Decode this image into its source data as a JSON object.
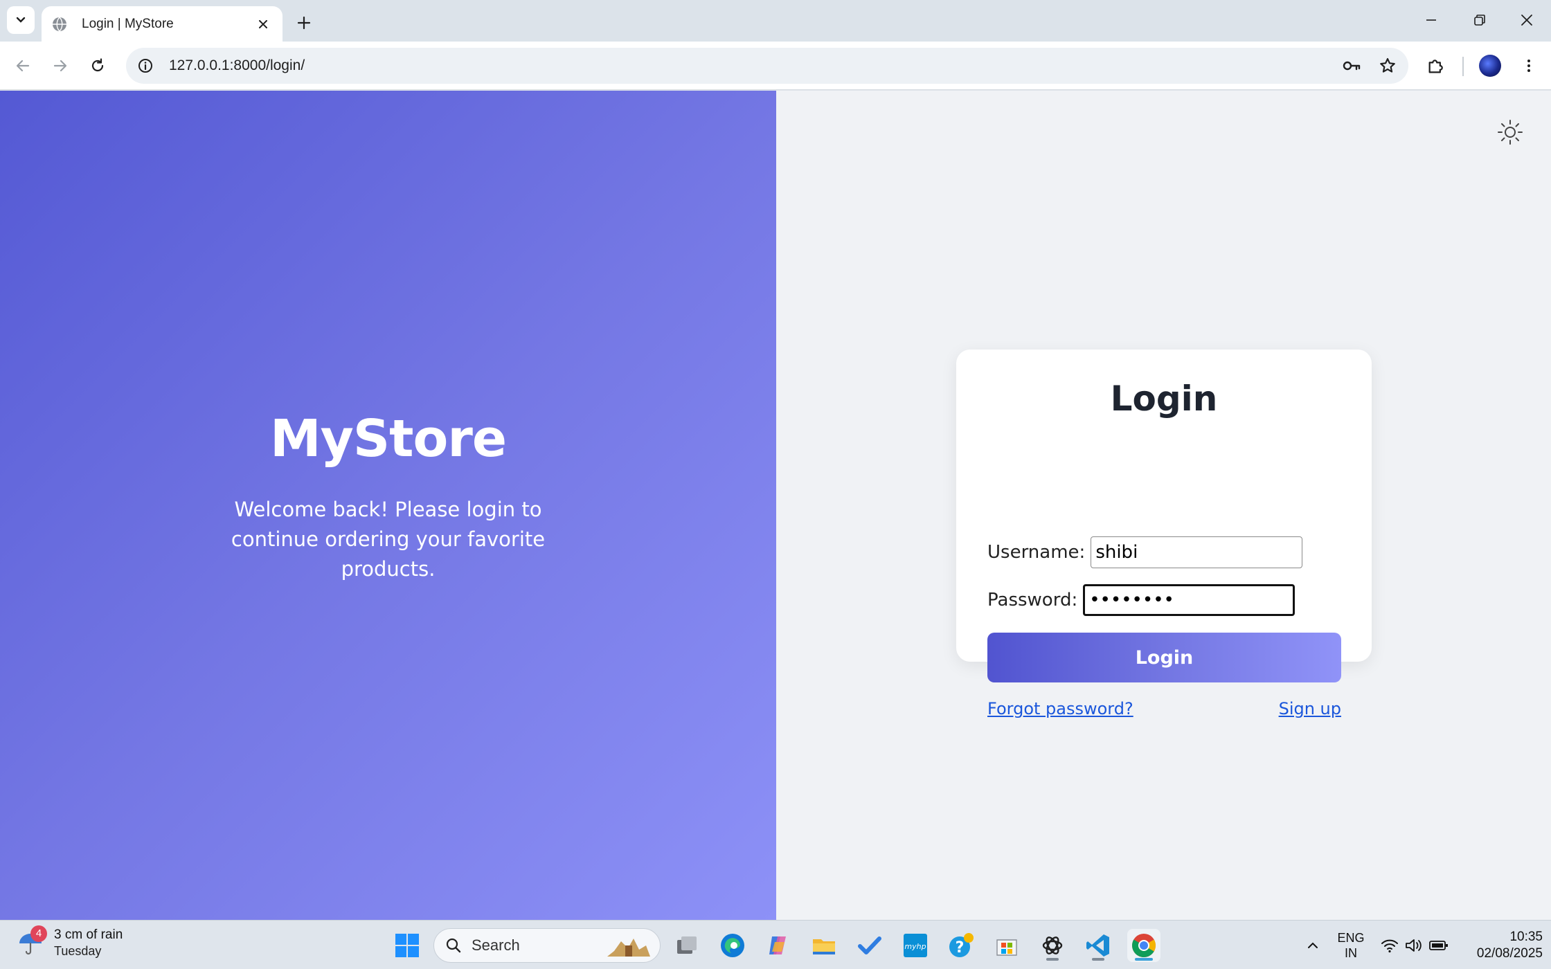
{
  "browser": {
    "tab_title": "Login | MyStore",
    "url": "127.0.0.1:8000/login/"
  },
  "brand": {
    "name": "MyStore",
    "tagline": "Welcome back! Please login to continue ordering your favorite products."
  },
  "login_form": {
    "title": "Login",
    "username_label": "Username:",
    "username_value": "shibi",
    "password_label": "Password:",
    "password_value": "••••••••",
    "submit_label": "Login",
    "forgot_link": "Forgot password?",
    "signup_link": "Sign up"
  },
  "colors": {
    "hero_gradient_start": "#5459d4",
    "hero_gradient_end": "#8d91f7",
    "page_background": "#f0f2f5",
    "button_gradient_start": "#5154d0",
    "button_gradient_end": "#9093f8",
    "link": "#1a56db"
  },
  "taskbar": {
    "weather": {
      "badge": "4",
      "line1": "3 cm of rain",
      "line2": "Tuesday"
    },
    "search_label": "Search",
    "apps": [
      "start-icon",
      "file-explorer-icon",
      "edge-icon",
      "copilot-icon",
      "folder-icon",
      "todo-icon",
      "myhp-icon",
      "help-icon",
      "store-icon",
      "chatgpt-icon",
      "vscode-icon",
      "chrome-icon"
    ],
    "language": {
      "line1": "ENG",
      "line2": "IN"
    },
    "time": "10:35",
    "date": "02/08/2025"
  }
}
